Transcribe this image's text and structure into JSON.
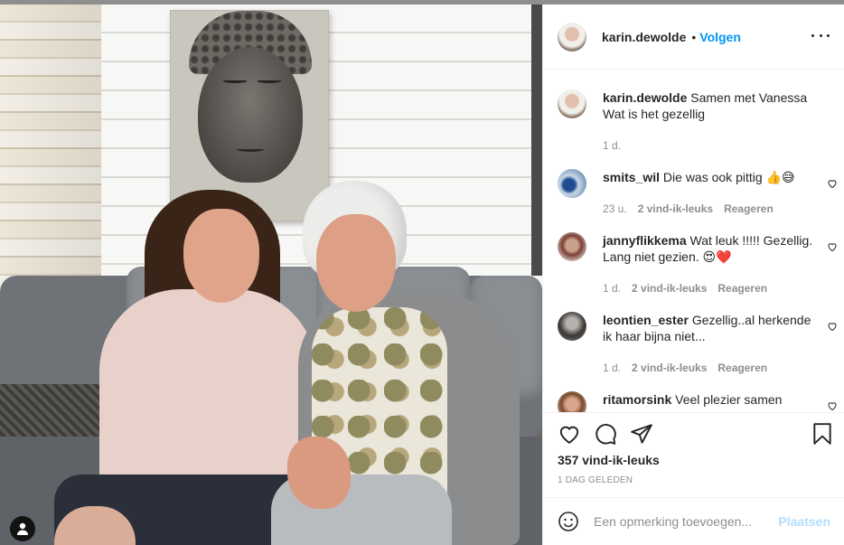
{
  "header": {
    "username": "karin.dewolde",
    "dot": "•",
    "follow_label": "Volgen"
  },
  "caption": {
    "username": "karin.dewolde",
    "text": "Samen met Vanessa Wat is het gezellig",
    "time": "1 d."
  },
  "comments": [
    {
      "username": "smits_wil",
      "text": "Die was ook pittig",
      "emoji": "👍😅",
      "time": "23 u.",
      "likes": "2 vind-ik-leuks",
      "reply": "Reageren"
    },
    {
      "username": "jannyflikkema",
      "text": "Wat leuk !!!!! Gezellig. Lang niet gezien.",
      "emoji": "😍❤️",
      "time": "1 d.",
      "likes": "2 vind-ik-leuks",
      "reply": "Reageren"
    },
    {
      "username": "leontien_ester",
      "text": "Gezellig..al herkende ik haar bijna niet...",
      "emoji": "",
      "time": "1 d.",
      "likes": "2 vind-ik-leuks",
      "reply": "Reageren"
    },
    {
      "username": "ritamorsink",
      "text": "Veel plezier samen",
      "emoji": "",
      "time": "",
      "likes": "",
      "reply": ""
    }
  ],
  "actions": {
    "likes_count": "357 vind-ik-leuks",
    "date": "1 DAG GELEDEN"
  },
  "add_comment": {
    "placeholder": "Een opmerking toevoegen...",
    "post_label": "Plaatsen"
  },
  "colors": {
    "link_blue": "#0095f6",
    "post_disabled": "#b2dffc",
    "muted_text": "#8e8e8e",
    "heart_red": "#ed4956"
  },
  "icons": [
    "user-tag-icon",
    "more-icon",
    "heart-icon",
    "comment-icon",
    "share-icon",
    "bookmark-icon",
    "smile-icon",
    "comment-like-icon"
  ]
}
